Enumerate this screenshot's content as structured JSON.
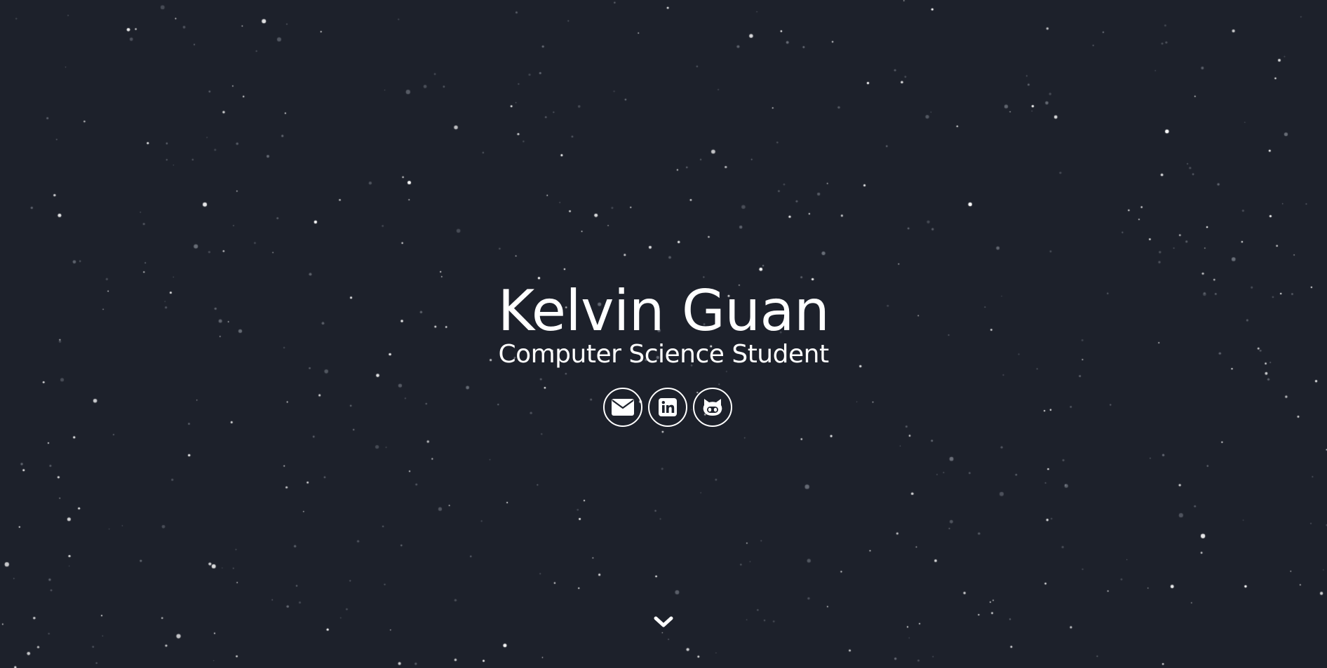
{
  "hero": {
    "name": "Kelvin Guan",
    "subtitle": "Computer Science Student"
  },
  "social": [
    {
      "id": "email",
      "icon": "envelope-icon"
    },
    {
      "id": "linkedin",
      "icon": "linkedin-icon"
    },
    {
      "id": "github",
      "icon": "github-icon"
    }
  ],
  "scroll": {
    "icon": "chevron-down-icon"
  },
  "colors": {
    "background": "#1d212b",
    "foreground": "#ffffff",
    "star": "#ffffff",
    "star_dim": "#8a8f99"
  }
}
